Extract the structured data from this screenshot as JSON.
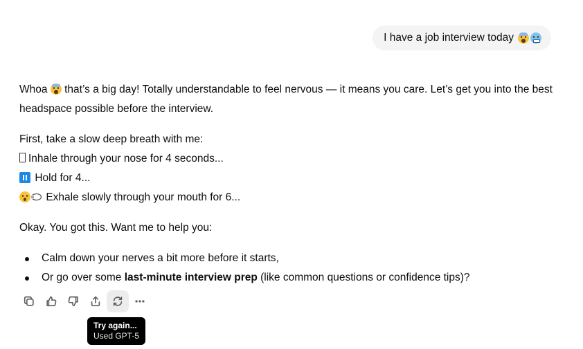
{
  "user_message": {
    "text": "I have a job interview today",
    "emoji_1": "fearful-screaming-face",
    "emoji_2": "cold-face"
  },
  "assistant_message": {
    "p1_before": "Whoa",
    "p1_emoji": "screaming-face",
    "p1_after": "that’s a big day! Totally understandable to feel nervous — it means you care. Let’s get you into the best headspace possible before the interview.",
    "p2_line1": "First, take a slow deep breath with me:",
    "p2_line2": "Inhale through your nose for 4 seconds...",
    "p2_line3": "Hold for 4...",
    "p2_line4": "Exhale slowly through your mouth for 6...",
    "p3": "Okay. You got this. Want me to help you:",
    "bullets": [
      {
        "text": "Calm down your nerves a bit more before it starts,"
      },
      {
        "prefix": "Or go over some ",
        "bold": "last-minute interview prep",
        "suffix": " (like common questions or confidence tips)?"
      }
    ]
  },
  "actions": {
    "copy": "copy-icon",
    "like": "thumbs-up-icon",
    "dislike": "thumbs-down-icon",
    "share": "share-icon",
    "regenerate": "regenerate-icon",
    "more": "more-icon"
  },
  "tooltip": {
    "title": "Try again...",
    "subtitle": "Used GPT-5"
  }
}
